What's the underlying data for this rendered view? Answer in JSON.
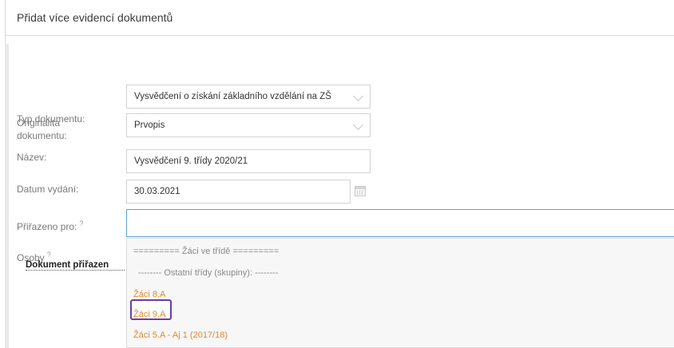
{
  "dialog": {
    "title": "Přidat více evidencí dokumentů"
  },
  "form": {
    "doc_type": {
      "label": "Typ dokumentu:",
      "value": "Vysvědčení o získání základního vzdělání na ZŠ"
    },
    "originality": {
      "label_line1": "Originalita",
      "label_line2": "dokumentu:",
      "value": "Prvopis"
    },
    "name": {
      "label": "Název:",
      "value": "Vysvědčení 9. třídy 2020/21"
    },
    "issue_date": {
      "label": "Datum vydání:",
      "value": "30.03.2021"
    },
    "assigned_to": {
      "label": "Přiřazeno pro:",
      "help": "?",
      "value": ""
    },
    "persons": {
      "label": "Osoby",
      "help": "?",
      "subheading": "Dokument přiřazen"
    }
  },
  "dropdown": {
    "group_header": "========= Žáci ve třídě =========",
    "other_group": "-------- Ostatní třídy (skupiny): --------",
    "options": [
      "Žáci 8.A",
      "Žáci 9.A",
      "Žáci 5.A - Aj 1 (2017/18)"
    ],
    "selected_index": 1
  },
  "colors": {
    "option_text": "#e0882c",
    "selected_border": "#6a3fa0",
    "focus_border": "#5ba1d8"
  }
}
